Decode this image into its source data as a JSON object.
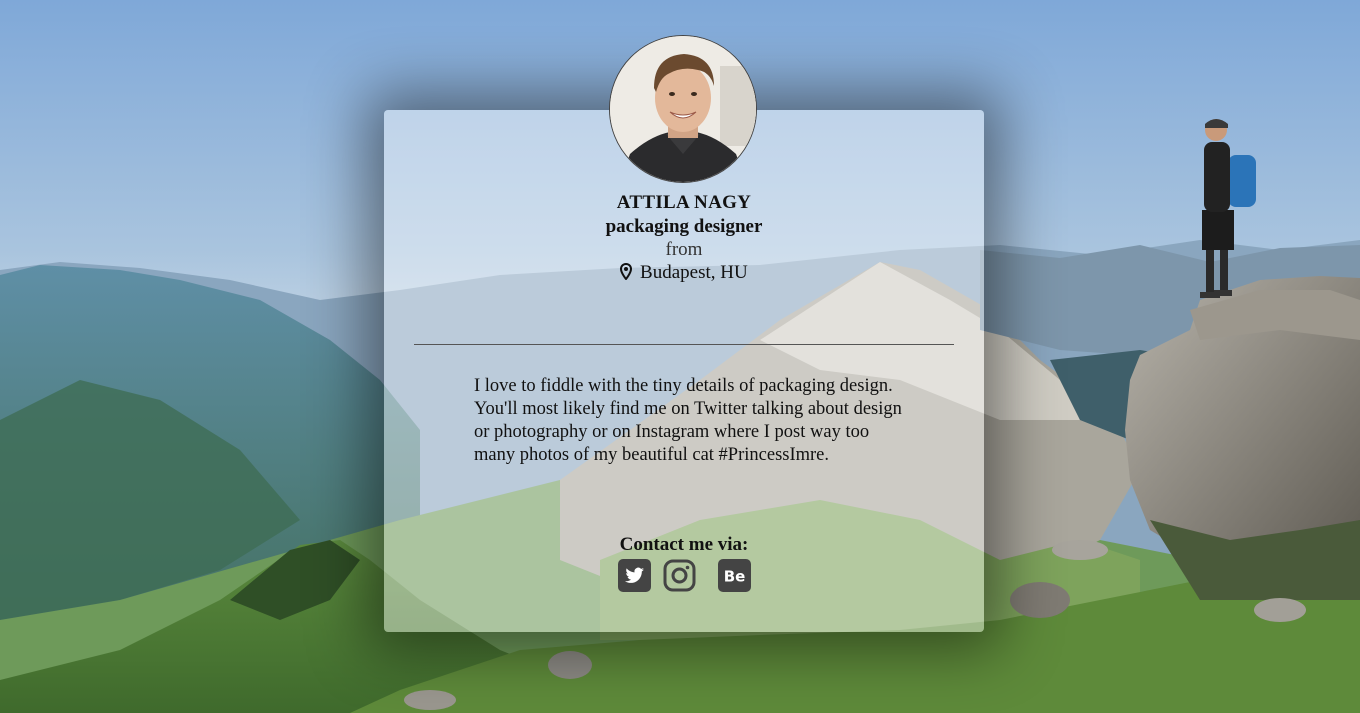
{
  "profile": {
    "name": "ATTILA NAGY",
    "title": "packaging designer",
    "from_label": "from",
    "location": "Budapest, HU"
  },
  "bio": "I love to fiddle with the tiny details of packaging design. You'll most likely find me on Twitter talking about design or photography or on Instagram where I post way too many photos of my beautiful cat #PrincessImre.",
  "contact": {
    "label": "Contact me via:",
    "links": [
      {
        "name": "Twitter",
        "icon": "twitter-icon"
      },
      {
        "name": "Instagram",
        "icon": "instagram-icon"
      },
      {
        "name": "Behance",
        "icon": "behance-icon"
      }
    ]
  },
  "colors": {
    "icon": "#444444",
    "card_bg": "rgba(255,255,255,0.42)"
  }
}
